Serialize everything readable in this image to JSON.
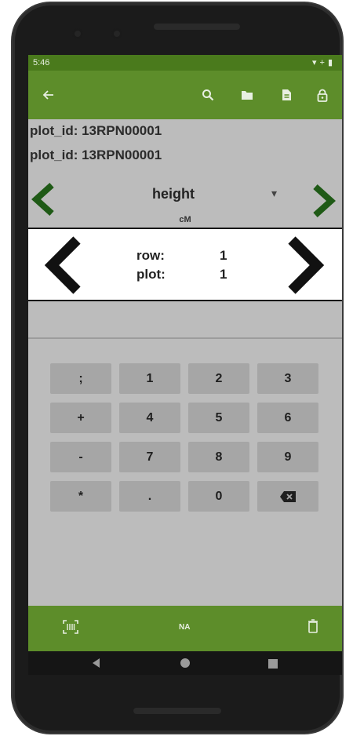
{
  "status_bar": {
    "time": "5:46",
    "icons": [
      "wifi-icon",
      "signal-icon",
      "battery-icon"
    ]
  },
  "toolbar": {
    "back_icon": "back-arrow-icon",
    "actions": [
      "search-icon",
      "folder-icon",
      "document-icon",
      "lock-icon"
    ]
  },
  "info": {
    "line1": "plot_id: 13RPN00001",
    "line2": "plot_id: 13RPN00001"
  },
  "trait": {
    "name": "height",
    "units": "cM",
    "prev_icon": "chevron-left-icon",
    "next_icon": "chevron-right-icon"
  },
  "range": {
    "row_label": "row:",
    "row_value": "1",
    "plot_label": "plot:",
    "plot_value": "1"
  },
  "keypad": {
    "rows": [
      [
        ";",
        "1",
        "2",
        "3"
      ],
      [
        "+",
        "4",
        "5",
        "6"
      ],
      [
        "-",
        "7",
        "8",
        "9"
      ],
      [
        "*",
        ".",
        "0",
        "backspace-icon"
      ]
    ]
  },
  "bottom_bar": {
    "barcode_icon": "barcode-scan-icon",
    "na_label": "NA",
    "delete_icon": "trash-icon"
  },
  "nav_bar": [
    "nav-back-icon",
    "nav-home-icon",
    "nav-recents-icon"
  ],
  "colors": {
    "primary": "#5d8d2a",
    "status": "#4a7a1c",
    "arrow_green": "#1f5a16",
    "screen_bg": "#bcbcbc",
    "key_bg": "#a6a6a6"
  }
}
